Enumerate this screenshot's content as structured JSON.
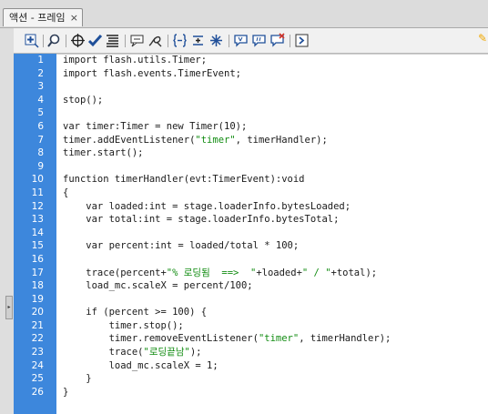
{
  "panel": {
    "tab_title": "액션 - 프레임",
    "close_glyph": "×",
    "collapse_glyph": "▸"
  },
  "toolbar": {
    "pin_glyph": "✎",
    "buttons": [
      "add-script-item",
      "find-replace",
      "insert-target-path",
      "check-syntax",
      "auto-format",
      "show-code-hint",
      "debug-options",
      "collapse-between-braces",
      "collapse-selection",
      "expand-all",
      "apply-block-comment",
      "apply-line-comment",
      "remove-comment",
      "show-hide-toolbox"
    ]
  },
  "code_lines": [
    {
      "n": "1",
      "segs": [
        {
          "t": "import flash.utils.Timer;"
        }
      ]
    },
    {
      "n": "2",
      "segs": [
        {
          "t": "import flash.events.TimerEvent;"
        }
      ]
    },
    {
      "n": "3",
      "segs": [
        {
          "t": ""
        }
      ]
    },
    {
      "n": "4",
      "segs": [
        {
          "t": "stop();"
        }
      ]
    },
    {
      "n": "5",
      "segs": [
        {
          "t": ""
        }
      ]
    },
    {
      "n": "6",
      "segs": [
        {
          "t": "var timer:Timer = new Timer(10);"
        }
      ]
    },
    {
      "n": "7",
      "segs": [
        {
          "t": "timer.addEventListener("
        },
        {
          "t": "\"timer\"",
          "s": 1
        },
        {
          "t": ", timerHandler);"
        }
      ]
    },
    {
      "n": "8",
      "segs": [
        {
          "t": "timer.start();"
        }
      ]
    },
    {
      "n": "9",
      "segs": [
        {
          "t": ""
        }
      ]
    },
    {
      "n": "10",
      "segs": [
        {
          "t": "function timerHandler(evt:TimerEvent):void"
        }
      ]
    },
    {
      "n": "11",
      "segs": [
        {
          "t": "{"
        }
      ]
    },
    {
      "n": "12",
      "segs": [
        {
          "t": "    var loaded:int = stage.loaderInfo.bytesLoaded;"
        }
      ]
    },
    {
      "n": "13",
      "segs": [
        {
          "t": "    var total:int = stage.loaderInfo.bytesTotal;"
        }
      ]
    },
    {
      "n": "14",
      "segs": [
        {
          "t": ""
        }
      ]
    },
    {
      "n": "15",
      "segs": [
        {
          "t": "    var percent:int = loaded/total * 100;"
        }
      ]
    },
    {
      "n": "16",
      "segs": [
        {
          "t": ""
        }
      ]
    },
    {
      "n": "17",
      "segs": [
        {
          "t": "    trace(percent+"
        },
        {
          "t": "\"% 로딩됨  ==>  \"",
          "s": 1
        },
        {
          "t": "+loaded+"
        },
        {
          "t": "\" / \"",
          "s": 1
        },
        {
          "t": "+total);"
        }
      ]
    },
    {
      "n": "18",
      "segs": [
        {
          "t": "    load_mc.scaleX = percent/100;"
        }
      ]
    },
    {
      "n": "19",
      "segs": [
        {
          "t": ""
        }
      ]
    },
    {
      "n": "20",
      "segs": [
        {
          "t": "    if (percent >= 100) {"
        }
      ]
    },
    {
      "n": "21",
      "segs": [
        {
          "t": "        timer.stop();"
        }
      ]
    },
    {
      "n": "22",
      "segs": [
        {
          "t": "        timer.removeEventListener("
        },
        {
          "t": "\"timer\"",
          "s": 1
        },
        {
          "t": ", timerHandler);"
        }
      ]
    },
    {
      "n": "23",
      "segs": [
        {
          "t": "        trace("
        },
        {
          "t": "\"로딩끝남\"",
          "s": 1
        },
        {
          "t": ");"
        }
      ]
    },
    {
      "n": "24",
      "segs": [
        {
          "t": "        load_mc.scaleX = 1;"
        }
      ]
    },
    {
      "n": "25",
      "segs": [
        {
          "t": "    }"
        }
      ]
    },
    {
      "n": "26",
      "segs": [
        {
          "t": "}"
        }
      ]
    }
  ]
}
